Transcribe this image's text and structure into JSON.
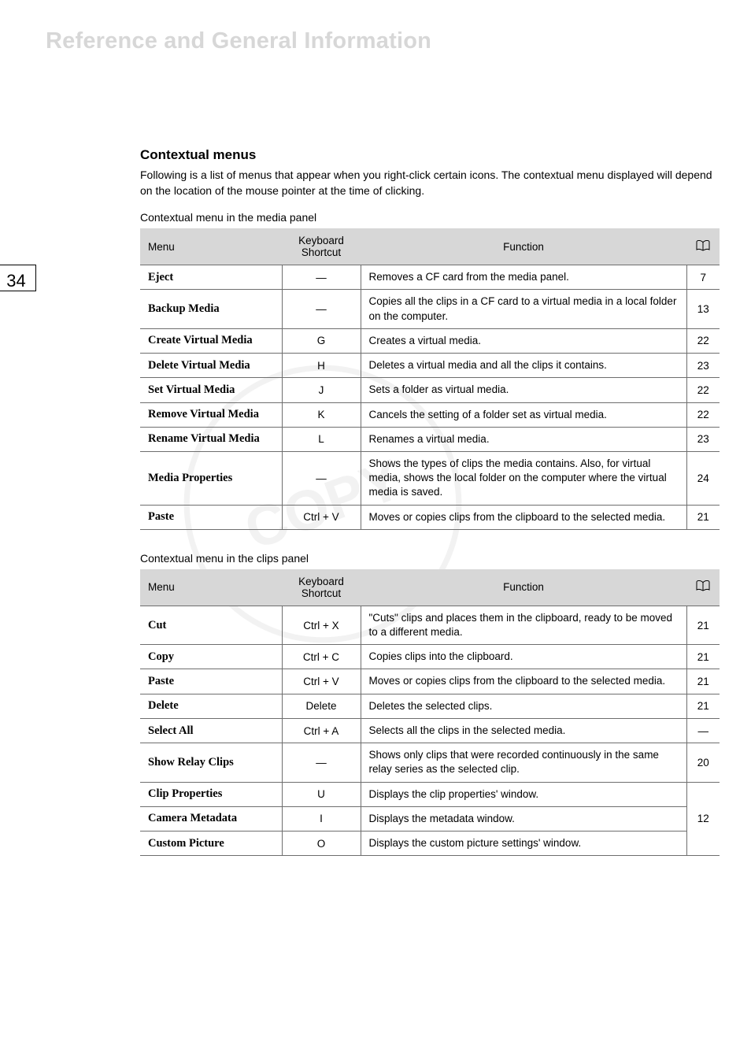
{
  "chapter_title": "Reference and General Information",
  "page_side_number": "34",
  "section": {
    "heading": "Contextual menus",
    "intro": "Following is a list of menus that appear when you right-click certain icons. The contextual menu displayed will depend on the location of the mouse pointer at the time of clicking."
  },
  "table1": {
    "title": "Contextual menu in the media panel",
    "headers": {
      "menu": "Menu",
      "shortcut": "Keyboard Shortcut",
      "function": "Function"
    },
    "rows": [
      {
        "menu": "Eject",
        "shortcut": "—",
        "function": "Removes a CF card from the media panel.",
        "page": "7"
      },
      {
        "menu": "Backup Media",
        "shortcut": "—",
        "function": "Copies all the clips in a CF card to a virtual media in a local folder on the computer.",
        "page": "13"
      },
      {
        "menu": "Create Virtual Media",
        "shortcut": "G",
        "function": "Creates a virtual media.",
        "page": "22"
      },
      {
        "menu": "Delete Virtual Media",
        "shortcut": "H",
        "function": "Deletes a virtual media and all the clips it contains.",
        "page": "23"
      },
      {
        "menu": "Set Virtual Media",
        "shortcut": "J",
        "function": "Sets a folder as virtual media.",
        "page": "22"
      },
      {
        "menu": "Remove Virtual Media",
        "shortcut": "K",
        "function": "Cancels the setting of a folder set as virtual media.",
        "page": "22"
      },
      {
        "menu": "Rename Virtual Media",
        "shortcut": "L",
        "function": "Renames a virtual media.",
        "page": "23"
      },
      {
        "menu": "Media Properties",
        "shortcut": "—",
        "function": "Shows the types of clips the media contains. Also, for virtual media, shows the local folder on the computer where the virtual media is saved.",
        "page": "24"
      },
      {
        "menu": "Paste",
        "shortcut": "Ctrl + V",
        "function": "Moves or copies clips from the clipboard to the selected media.",
        "page": "21"
      }
    ]
  },
  "table2": {
    "title": "Contextual menu in the clips panel",
    "headers": {
      "menu": "Menu",
      "shortcut": "Keyboard Shortcut",
      "function": "Function"
    },
    "rows": [
      {
        "menu": "Cut",
        "shortcut": "Ctrl + X",
        "function": "\"Cuts\" clips and places them in the clipboard, ready to be moved to a different media.",
        "page": "21"
      },
      {
        "menu": "Copy",
        "shortcut": "Ctrl + C",
        "function": "Copies clips into the clipboard.",
        "page": "21"
      },
      {
        "menu": "Paste",
        "shortcut": "Ctrl + V",
        "function": "Moves or copies clips from the clipboard to the selected media.",
        "page": "21"
      },
      {
        "menu": "Delete",
        "shortcut": "Delete",
        "function": "Deletes the selected clips.",
        "page": "21"
      },
      {
        "menu": "Select All",
        "shortcut": "Ctrl + A",
        "function": "Selects all the clips in the selected media.",
        "page": "—"
      },
      {
        "menu": "Show Relay Clips",
        "shortcut": "—",
        "function": "Shows only clips that were recorded continuously in the same relay series as the selected clip.",
        "page": "20"
      },
      {
        "menu": "Clip Properties",
        "shortcut": "U",
        "function": "Displays the clip properties' window.",
        "page": "12",
        "grouped": true,
        "first": true
      },
      {
        "menu": "Camera Metadata",
        "shortcut": "I",
        "function": "Displays the metadata window.",
        "page": "",
        "grouped": true
      },
      {
        "menu": "Custom Picture",
        "shortcut": "O",
        "function": "Displays the custom picture settings' window.",
        "page": "",
        "grouped": true
      }
    ]
  }
}
